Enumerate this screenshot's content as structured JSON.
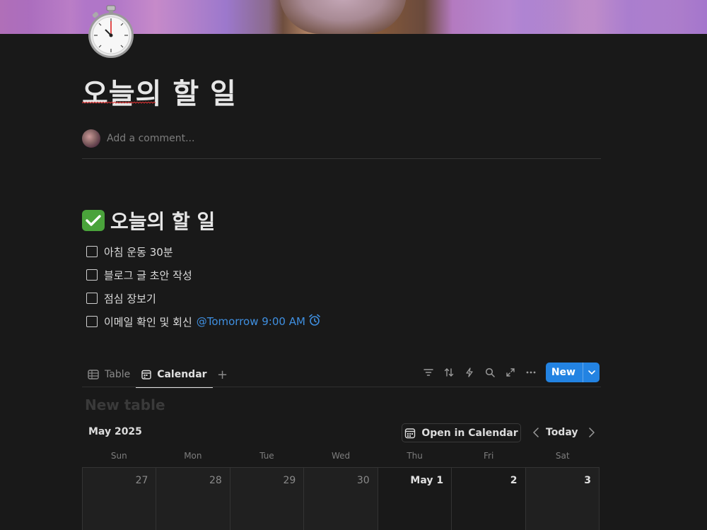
{
  "page": {
    "icon": "stopwatch-icon",
    "title": "오늘의 할 일",
    "comment_placeholder": "Add a comment..."
  },
  "section": {
    "heading": "오늘의 할 일",
    "heading_icon": "check-mark-button-icon",
    "todos": [
      {
        "text": "아침 운동 30분",
        "checked": false
      },
      {
        "text": "블로그 글 초안 작성",
        "checked": false
      },
      {
        "text": "점심 장보기",
        "checked": false
      },
      {
        "text": "이메일 확인 및 회신",
        "checked": false,
        "reminder": "@Tomorrow 9:00 AM"
      }
    ]
  },
  "database": {
    "tabs": [
      {
        "label": "Table",
        "icon": "table-icon",
        "active": false
      },
      {
        "label": "Calendar",
        "icon": "calendar-icon",
        "active": true
      }
    ],
    "add_view": "+",
    "toolbar_icons": [
      "filter-icon",
      "sort-icon",
      "automation-icon",
      "search-icon",
      "expand-icon",
      "more-icon"
    ],
    "new_button": "New",
    "title": "New table",
    "colors": {
      "accent": "#2383e2",
      "mention": "#3f8fe0"
    }
  },
  "calendar": {
    "month": "May 2025",
    "open_button": "Open in Calendar",
    "today_button": "Today",
    "weekdays": [
      "Sun",
      "Mon",
      "Tue",
      "Wed",
      "Thu",
      "Fri",
      "Sat"
    ],
    "days": [
      {
        "label": "27",
        "current_month": false
      },
      {
        "label": "28",
        "current_month": false
      },
      {
        "label": "29",
        "current_month": false
      },
      {
        "label": "30",
        "current_month": false
      },
      {
        "label": "May 1",
        "current_month": true
      },
      {
        "label": "2",
        "current_month": true
      },
      {
        "label": "3",
        "current_month": true
      }
    ]
  }
}
